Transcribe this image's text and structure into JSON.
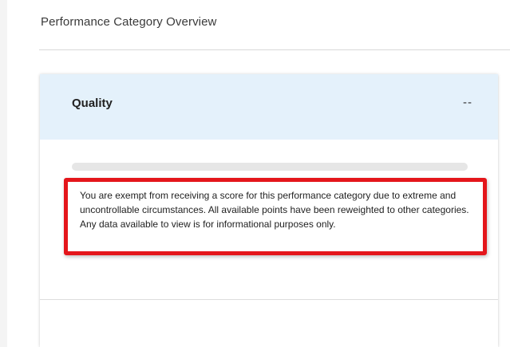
{
  "overview": {
    "title": "Performance Category Overview"
  },
  "category": {
    "name": "Quality",
    "score": "--",
    "progress_fraction": 0,
    "exemption_message": "You are exempt from receiving a score for this performance category due to extreme and uncontrollable circumstances. All available points have been reweighted to other categories. Any data available to view is for informational purposes only."
  },
  "colors": {
    "header_background": "#e4f1fb",
    "highlight_border": "#e4161b",
    "progress_track": "#e6e6e6"
  }
}
